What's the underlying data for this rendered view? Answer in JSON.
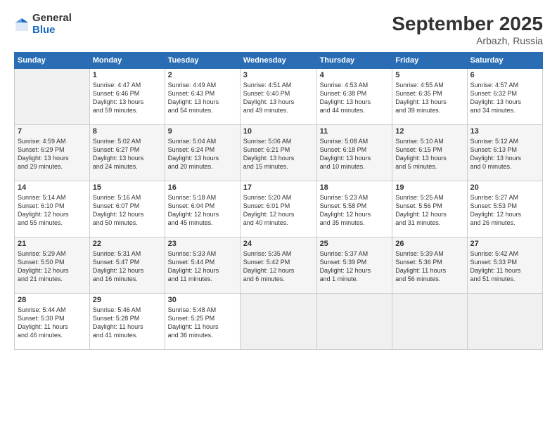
{
  "header": {
    "logo_general": "General",
    "logo_blue": "Blue",
    "month": "September 2025",
    "location": "Arbazh, Russia"
  },
  "weekdays": [
    "Sunday",
    "Monday",
    "Tuesday",
    "Wednesday",
    "Thursday",
    "Friday",
    "Saturday"
  ],
  "weeks": [
    [
      {
        "day": "",
        "info": ""
      },
      {
        "day": "1",
        "info": "Sunrise: 4:47 AM\nSunset: 6:46 PM\nDaylight: 13 hours\nand 59 minutes."
      },
      {
        "day": "2",
        "info": "Sunrise: 4:49 AM\nSunset: 6:43 PM\nDaylight: 13 hours\nand 54 minutes."
      },
      {
        "day": "3",
        "info": "Sunrise: 4:51 AM\nSunset: 6:40 PM\nDaylight: 13 hours\nand 49 minutes."
      },
      {
        "day": "4",
        "info": "Sunrise: 4:53 AM\nSunset: 6:38 PM\nDaylight: 13 hours\nand 44 minutes."
      },
      {
        "day": "5",
        "info": "Sunrise: 4:55 AM\nSunset: 6:35 PM\nDaylight: 13 hours\nand 39 minutes."
      },
      {
        "day": "6",
        "info": "Sunrise: 4:57 AM\nSunset: 6:32 PM\nDaylight: 13 hours\nand 34 minutes."
      }
    ],
    [
      {
        "day": "7",
        "info": "Sunrise: 4:59 AM\nSunset: 6:29 PM\nDaylight: 13 hours\nand 29 minutes."
      },
      {
        "day": "8",
        "info": "Sunrise: 5:02 AM\nSunset: 6:27 PM\nDaylight: 13 hours\nand 24 minutes."
      },
      {
        "day": "9",
        "info": "Sunrise: 5:04 AM\nSunset: 6:24 PM\nDaylight: 13 hours\nand 20 minutes."
      },
      {
        "day": "10",
        "info": "Sunrise: 5:06 AM\nSunset: 6:21 PM\nDaylight: 13 hours\nand 15 minutes."
      },
      {
        "day": "11",
        "info": "Sunrise: 5:08 AM\nSunset: 6:18 PM\nDaylight: 13 hours\nand 10 minutes."
      },
      {
        "day": "12",
        "info": "Sunrise: 5:10 AM\nSunset: 6:15 PM\nDaylight: 13 hours\nand 5 minutes."
      },
      {
        "day": "13",
        "info": "Sunrise: 5:12 AM\nSunset: 6:13 PM\nDaylight: 13 hours\nand 0 minutes."
      }
    ],
    [
      {
        "day": "14",
        "info": "Sunrise: 5:14 AM\nSunset: 6:10 PM\nDaylight: 12 hours\nand 55 minutes."
      },
      {
        "day": "15",
        "info": "Sunrise: 5:16 AM\nSunset: 6:07 PM\nDaylight: 12 hours\nand 50 minutes."
      },
      {
        "day": "16",
        "info": "Sunrise: 5:18 AM\nSunset: 6:04 PM\nDaylight: 12 hours\nand 45 minutes."
      },
      {
        "day": "17",
        "info": "Sunrise: 5:20 AM\nSunset: 6:01 PM\nDaylight: 12 hours\nand 40 minutes."
      },
      {
        "day": "18",
        "info": "Sunrise: 5:23 AM\nSunset: 5:58 PM\nDaylight: 12 hours\nand 35 minutes."
      },
      {
        "day": "19",
        "info": "Sunrise: 5:25 AM\nSunset: 5:56 PM\nDaylight: 12 hours\nand 31 minutes."
      },
      {
        "day": "20",
        "info": "Sunrise: 5:27 AM\nSunset: 5:53 PM\nDaylight: 12 hours\nand 26 minutes."
      }
    ],
    [
      {
        "day": "21",
        "info": "Sunrise: 5:29 AM\nSunset: 5:50 PM\nDaylight: 12 hours\nand 21 minutes."
      },
      {
        "day": "22",
        "info": "Sunrise: 5:31 AM\nSunset: 5:47 PM\nDaylight: 12 hours\nand 16 minutes."
      },
      {
        "day": "23",
        "info": "Sunrise: 5:33 AM\nSunset: 5:44 PM\nDaylight: 12 hours\nand 11 minutes."
      },
      {
        "day": "24",
        "info": "Sunrise: 5:35 AM\nSunset: 5:42 PM\nDaylight: 12 hours\nand 6 minutes."
      },
      {
        "day": "25",
        "info": "Sunrise: 5:37 AM\nSunset: 5:39 PM\nDaylight: 12 hours\nand 1 minute."
      },
      {
        "day": "26",
        "info": "Sunrise: 5:39 AM\nSunset: 5:36 PM\nDaylight: 11 hours\nand 56 minutes."
      },
      {
        "day": "27",
        "info": "Sunrise: 5:42 AM\nSunset: 5:33 PM\nDaylight: 11 hours\nand 51 minutes."
      }
    ],
    [
      {
        "day": "28",
        "info": "Sunrise: 5:44 AM\nSunset: 5:30 PM\nDaylight: 11 hours\nand 46 minutes."
      },
      {
        "day": "29",
        "info": "Sunrise: 5:46 AM\nSunset: 5:28 PM\nDaylight: 11 hours\nand 41 minutes."
      },
      {
        "day": "30",
        "info": "Sunrise: 5:48 AM\nSunset: 5:25 PM\nDaylight: 11 hours\nand 36 minutes."
      },
      {
        "day": "",
        "info": ""
      },
      {
        "day": "",
        "info": ""
      },
      {
        "day": "",
        "info": ""
      },
      {
        "day": "",
        "info": ""
      }
    ]
  ]
}
